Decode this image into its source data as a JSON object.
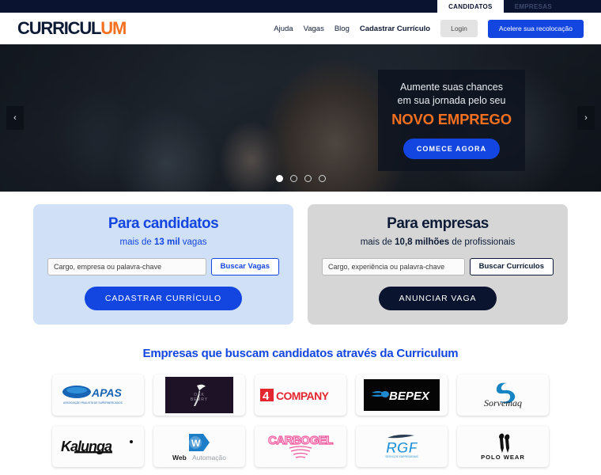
{
  "topbar": {
    "tabs": [
      {
        "label": "CANDIDATOS",
        "active": true
      },
      {
        "label": "EMPRESAS",
        "active": false
      }
    ]
  },
  "header": {
    "logo_main": "CURRICUL",
    "logo_accent": "UM",
    "nav": [
      {
        "label": "Ajuda",
        "bold": false
      },
      {
        "label": "Vagas",
        "bold": false
      },
      {
        "label": "Blog",
        "bold": false
      },
      {
        "label": "Cadastrar Currículo",
        "bold": true
      }
    ],
    "login_label": "Login",
    "cta_label": "Acelere sua recolocação"
  },
  "hero": {
    "prev_icon": "chevron-left-icon",
    "next_icon": "chevron-right-icon",
    "prev_glyph": "‹",
    "next_glyph": "›",
    "card": {
      "line1": "Aumente suas chances",
      "line2": "em sua jornada pelo seu",
      "highlight": "NOVO EMPREGO",
      "button": "COMECE AGORA",
      "highlight_color": "#f4701f",
      "button_color": "#1346e0"
    },
    "dots": {
      "count": 4,
      "active_index": 0
    }
  },
  "panels": {
    "candidates": {
      "title": "Para candidatos",
      "subtitle_pre": "mais de ",
      "subtitle_bold": "13 mil",
      "subtitle_post": " vagas",
      "search_placeholder": "Cargo, empresa ou palavra-chave",
      "search_value": "",
      "search_button": "Buscar Vagas",
      "main_button": "CADASTRAR CURRÍCULO",
      "accent_color": "#1346e0",
      "bg_color": "#cfe0f7"
    },
    "companies": {
      "title": "Para empresas",
      "subtitle_pre": "mais de ",
      "subtitle_bold": "10,8 milhões",
      "subtitle_post": " de profissionais",
      "search_placeholder": "Cargo, experiência ou palavra-chave",
      "search_value": "",
      "search_button": "Buscar Currículos",
      "main_button": "ANUNCIAR VAGA",
      "accent_color": "#0d1b36",
      "bg_color": "#d6d6d6"
    }
  },
  "companies_section": {
    "heading": "Empresas que buscam candidatos através da Curriculum",
    "logos": [
      {
        "name": "APAS",
        "sub": "ASSOCIAÇÃO PAULISTA DE SUPERMERCADOS"
      },
      {
        "name": "OAK BERRY",
        "sub": ""
      },
      {
        "name": "4 COMPANY",
        "sub": ""
      },
      {
        "name": "BEPEX",
        "sub": ""
      },
      {
        "name": "Sorvemaq",
        "sub": ""
      },
      {
        "name": "Kalunga",
        "sub": ""
      },
      {
        "name": "WebAutomação",
        "sub": ""
      },
      {
        "name": "CARBOGEL",
        "sub": ""
      },
      {
        "name": "RGF",
        "sub": ""
      },
      {
        "name": "POLO WEAR",
        "sub": ""
      }
    ]
  }
}
